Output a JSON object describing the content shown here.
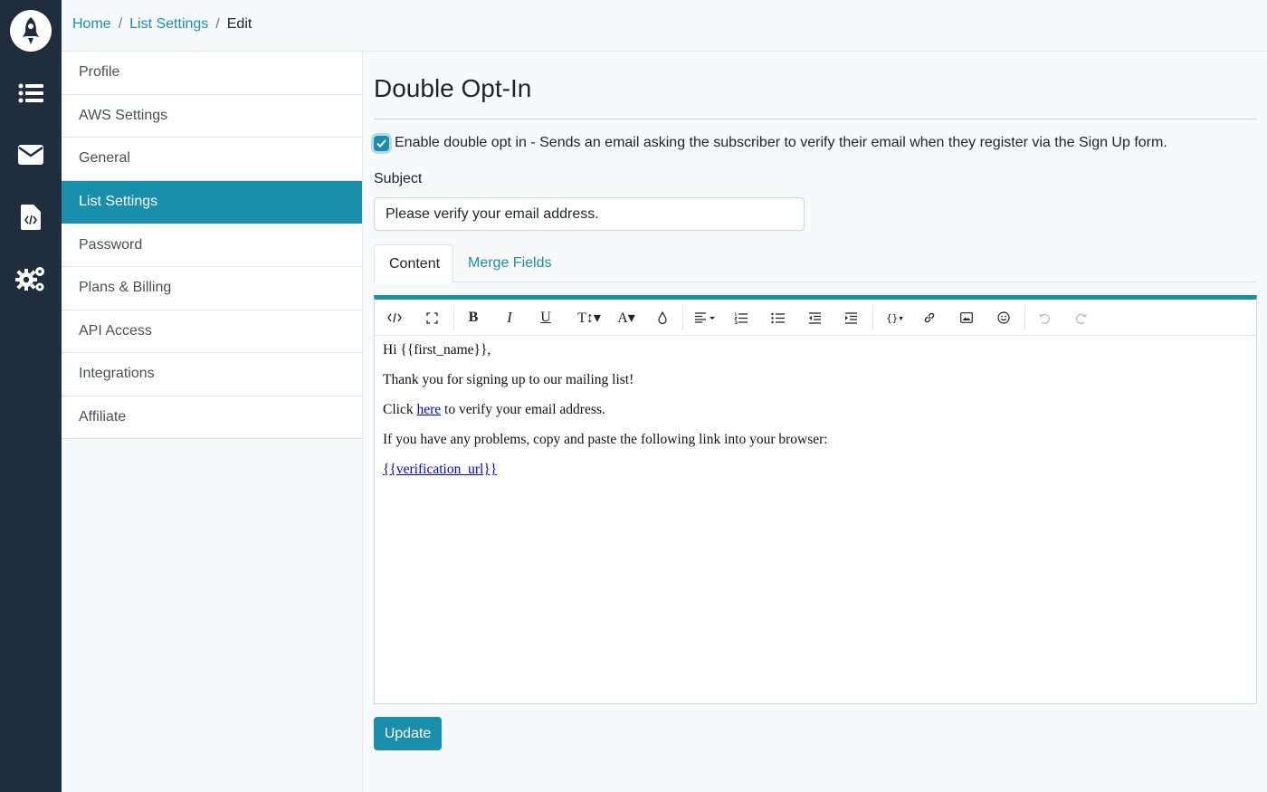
{
  "breadcrumb": {
    "home": "Home",
    "list_settings": "List Settings",
    "current": "Edit",
    "sep": "/"
  },
  "rail": {
    "icons": [
      "rocket-icon",
      "list-icon",
      "envelope-icon",
      "code-file-icon",
      "gears-icon"
    ]
  },
  "menu": {
    "items": [
      {
        "label": "Profile"
      },
      {
        "label": "AWS Settings"
      },
      {
        "label": "General"
      },
      {
        "label": "List Settings",
        "active": true
      },
      {
        "label": "Password"
      },
      {
        "label": "Plans & Billing"
      },
      {
        "label": "API Access"
      },
      {
        "label": "Integrations"
      },
      {
        "label": "Affiliate"
      }
    ]
  },
  "main": {
    "title": "Double Opt-In",
    "checkbox_label": "Enable double opt in - Sends an email asking the subscriber to verify their email when they register via the Sign Up form.",
    "checkbox_checked": true,
    "subject_label": "Subject",
    "subject_value": "Please verify your email address.",
    "tabs": [
      {
        "label": "Content",
        "active": true
      },
      {
        "label": "Merge Fields"
      }
    ],
    "editor": {
      "line1": "Hi {{first_name}},",
      "line2": "Thank you for signing up to our mailing list!",
      "line3_pre": "Click ",
      "line3_link": "here",
      "line3_post": " to verify your email address.",
      "line4": "If you have any problems, copy and paste the following link into your browser:",
      "line5_link": "{{verification_url}}"
    },
    "update_label": "Update"
  },
  "colors": {
    "accent": "#1a8fab",
    "rail": "#1f2d3d",
    "background": "#f7f9fb"
  }
}
